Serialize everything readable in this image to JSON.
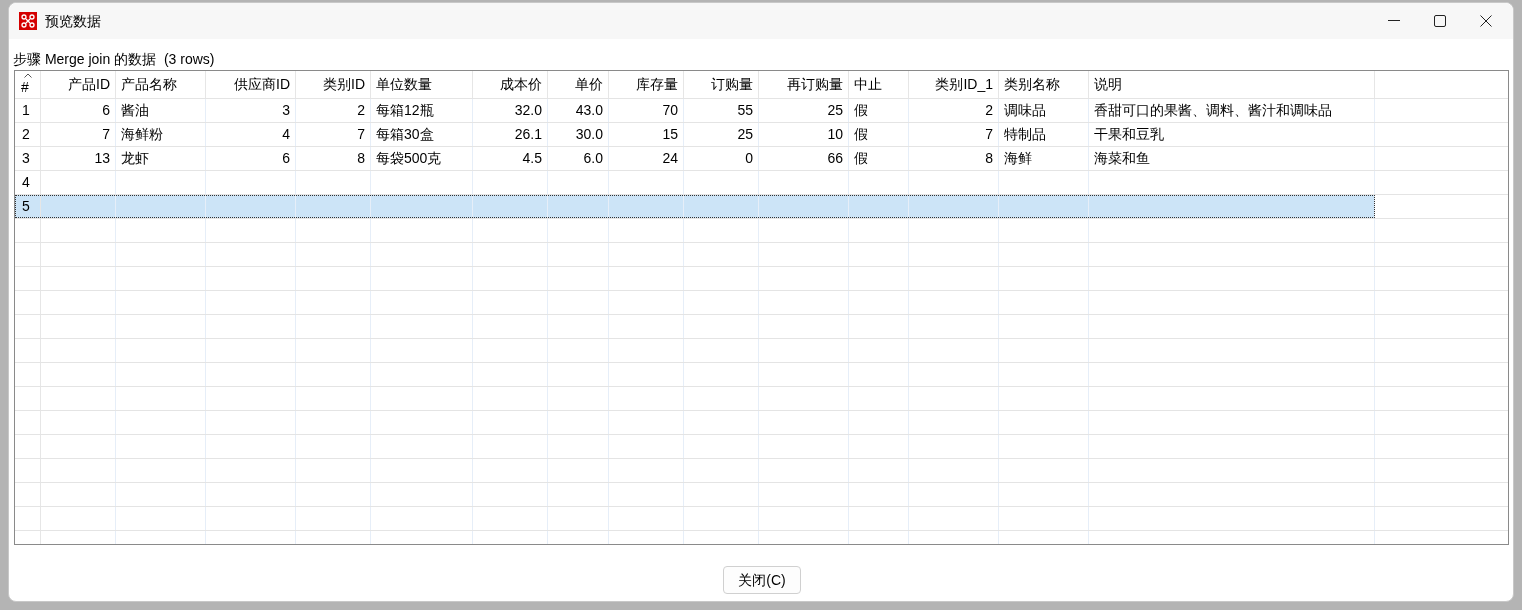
{
  "window": {
    "title": "预览数据"
  },
  "caption": "步骤 Merge join 的数据  (3 rows)",
  "table": {
    "index_header": "#",
    "columns": [
      {
        "label": "产品ID",
        "kind": "number"
      },
      {
        "label": "产品名称",
        "kind": "text"
      },
      {
        "label": "供应商ID",
        "kind": "number"
      },
      {
        "label": "类别ID",
        "kind": "number"
      },
      {
        "label": "单位数量",
        "kind": "text"
      },
      {
        "label": "成本价",
        "kind": "number"
      },
      {
        "label": "单价",
        "kind": "number"
      },
      {
        "label": "库存量",
        "kind": "number"
      },
      {
        "label": "订购量",
        "kind": "number"
      },
      {
        "label": "再订购量",
        "kind": "number"
      },
      {
        "label": "中止",
        "kind": "text"
      },
      {
        "label": "类别ID_1",
        "kind": "number"
      },
      {
        "label": "类别名称",
        "kind": "text"
      },
      {
        "label": "说明",
        "kind": "text"
      }
    ],
    "rows": [
      {
        "number": "1",
        "selected": false,
        "cells": [
          "6",
          "酱油",
          "3",
          "2",
          "每箱12瓶",
          "32.0",
          "43.0",
          "70",
          "55",
          "25",
          "假",
          "2",
          "调味品",
          "香甜可口的果酱、调料、酱汁和调味品"
        ]
      },
      {
        "number": "2",
        "selected": false,
        "cells": [
          "7",
          "海鲜粉",
          "4",
          "7",
          "每箱30盒",
          "26.1",
          "30.0",
          "15",
          "25",
          "10",
          "假",
          "7",
          "特制品",
          "干果和豆乳"
        ]
      },
      {
        "number": "3",
        "selected": false,
        "cells": [
          "13",
          "龙虾",
          "6",
          "8",
          "每袋500克",
          "4.5",
          "6.0",
          "24",
          "0",
          "66",
          "假",
          "8",
          "海鲜",
          "海菜和鱼"
        ]
      },
      {
        "number": "4",
        "selected": false
      },
      {
        "number": "5",
        "selected": true
      }
    ]
  },
  "buttons": [
    {
      "label": "关闭(C)"
    }
  ]
}
